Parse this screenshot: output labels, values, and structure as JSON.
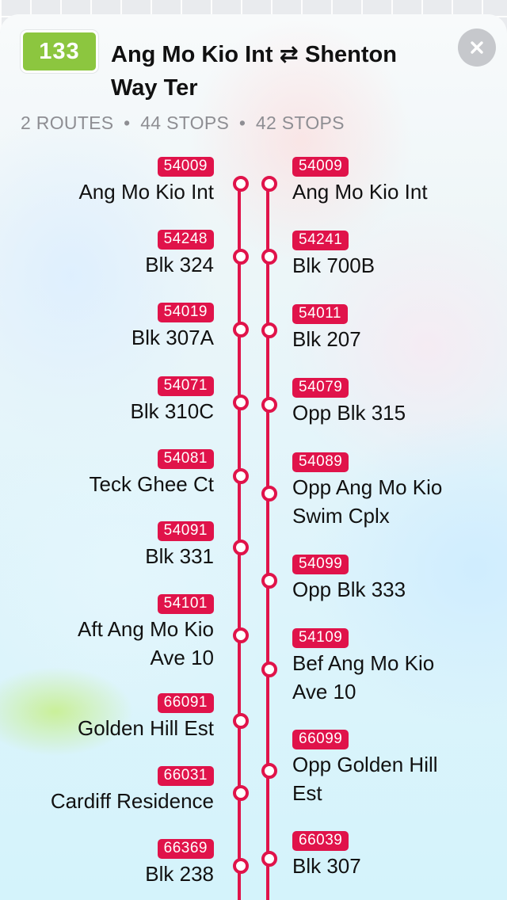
{
  "route": {
    "number": "133",
    "title": "Ang Mo Kio Int ⇄ Shenton Way Ter",
    "badge_color": "#8cc63f",
    "accent_color": "#e0134a"
  },
  "summary": {
    "routes": "2 ROUTES",
    "route1_stops": "44 STOPS",
    "route2_stops": "42 STOPS",
    "separator": "•"
  },
  "close_icon": "close-icon",
  "direction_1": {
    "stops": [
      {
        "code": "54009",
        "name": "Ang Mo Kio Int"
      },
      {
        "code": "54248",
        "name": "Blk 324"
      },
      {
        "code": "54019",
        "name": "Blk 307A"
      },
      {
        "code": "54071",
        "name": "Blk 310C"
      },
      {
        "code": "54081",
        "name": "Teck Ghee Ct"
      },
      {
        "code": "54091",
        "name": "Blk 331"
      },
      {
        "code": "54101",
        "name": "Aft Ang Mo Kio",
        "name2": "Ave 10"
      },
      {
        "code": "66091",
        "name": "Golden Hill Est"
      },
      {
        "code": "66031",
        "name": "Cardiff Residence"
      },
      {
        "code": "66369",
        "name": "Blk 238"
      }
    ]
  },
  "direction_2": {
    "stops": [
      {
        "code": "54009",
        "name": "Ang Mo Kio Int"
      },
      {
        "code": "54241",
        "name": "Blk 700B"
      },
      {
        "code": "54011",
        "name": "Blk 207"
      },
      {
        "code": "54079",
        "name": "Opp Blk 315"
      },
      {
        "code": "54089",
        "name": "Opp Ang Mo Kio",
        "name2": "Swim Cplx"
      },
      {
        "code": "54099",
        "name": "Opp Blk 333"
      },
      {
        "code": "54109",
        "name": "Bef Ang Mo Kio",
        "name2": "Ave 10"
      },
      {
        "code": "66099",
        "name": "Opp Golden Hill",
        "name2": "Est"
      },
      {
        "code": "66039",
        "name": "Blk 307"
      }
    ]
  }
}
